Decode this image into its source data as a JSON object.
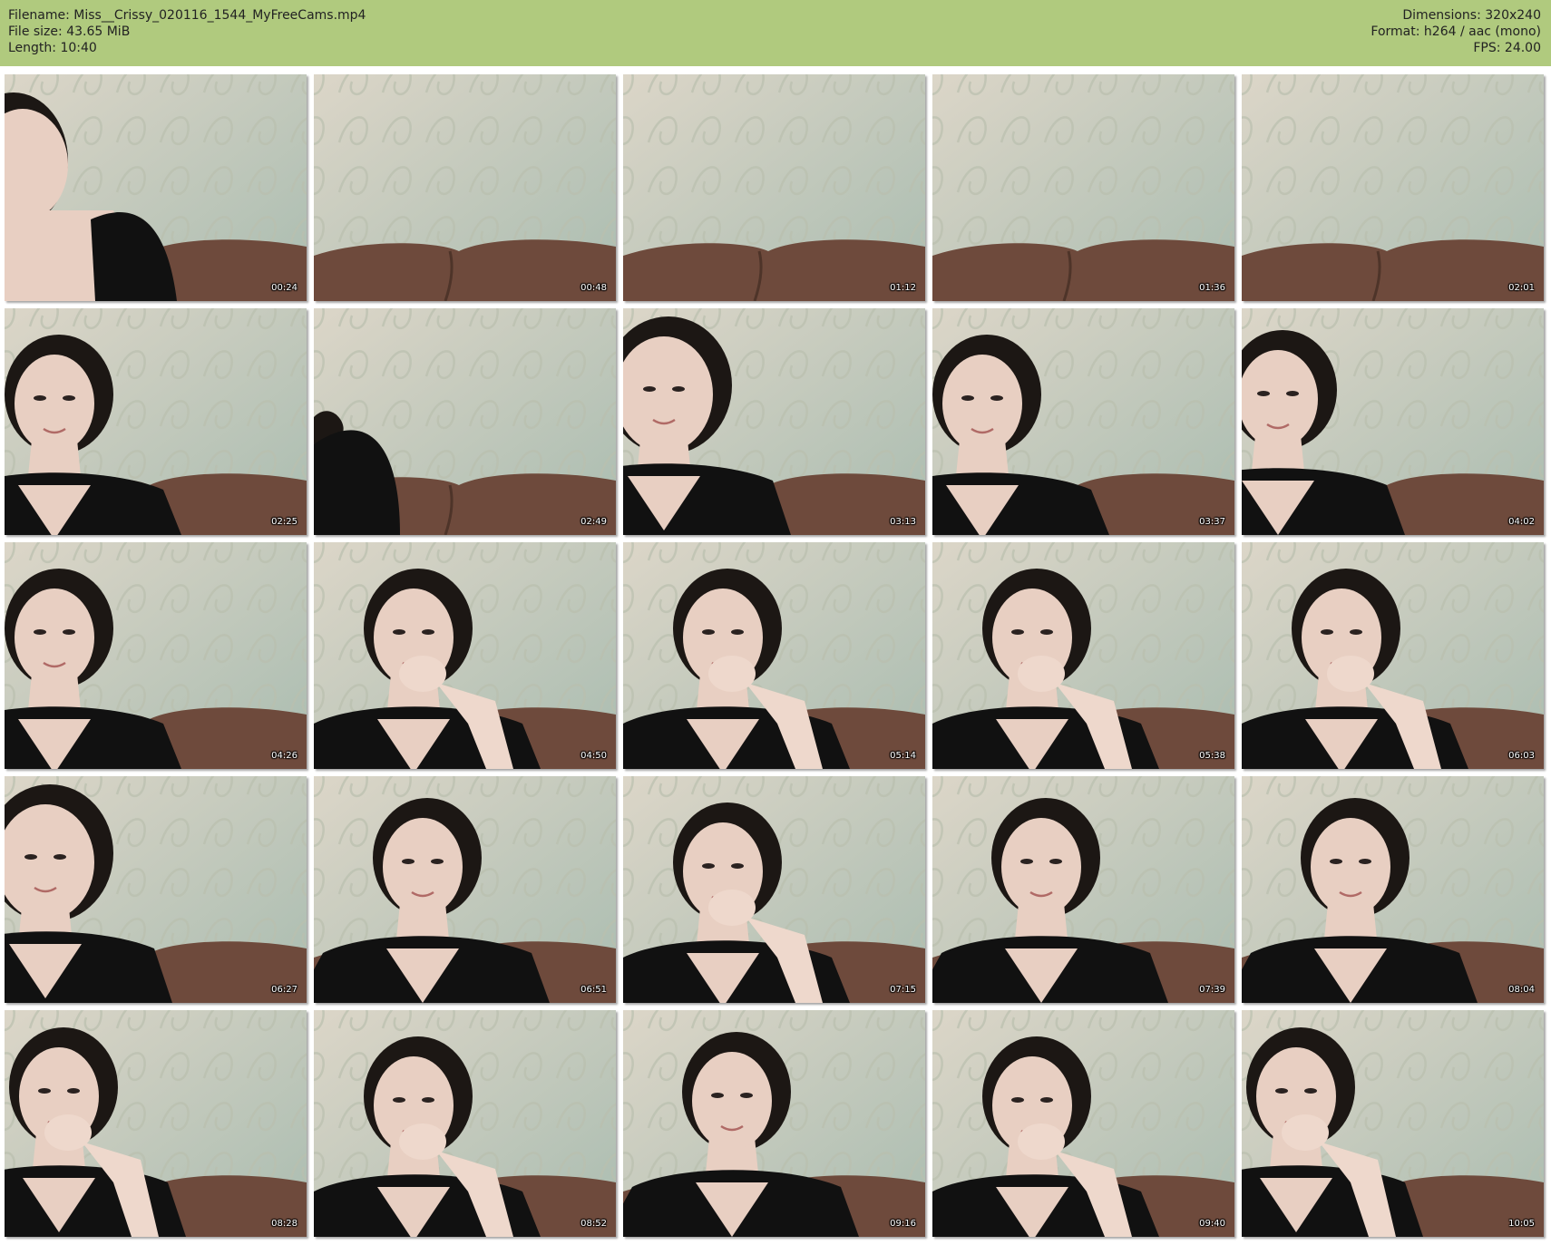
{
  "header": {
    "filename": "Filename: Miss__Crissy_020116_1544_MyFreeCams.mp4",
    "file_size": "File size: 43.65 MiB",
    "length": "Length: 10:40",
    "dimensions": "Dimensions: 320x240",
    "format": "Format: h264 / aac (mono)",
    "fps": "FPS: 24.00"
  },
  "colors": {
    "header_bg": "#b0ca7e",
    "wall": "#cfd3c5",
    "couch": "#6e4a3c",
    "shirt": "#111111",
    "skin": "#e8cfc2",
    "hair": "#1c1714"
  },
  "thumbnails": [
    {
      "time": "00:24",
      "person": "partial-left"
    },
    {
      "time": "00:48",
      "person": "none"
    },
    {
      "time": "01:12",
      "person": "none"
    },
    {
      "time": "01:36",
      "person": "none"
    },
    {
      "time": "02:01",
      "person": "none"
    },
    {
      "time": "02:25",
      "person": "left"
    },
    {
      "time": "02:49",
      "person": "shoulder"
    },
    {
      "time": "03:13",
      "person": "left-close"
    },
    {
      "time": "03:37",
      "person": "left"
    },
    {
      "time": "04:02",
      "person": "left-turned"
    },
    {
      "time": "04:26",
      "person": "left"
    },
    {
      "time": "04:50",
      "person": "center-hand"
    },
    {
      "time": "05:14",
      "person": "center-hand"
    },
    {
      "time": "05:38",
      "person": "center-hand"
    },
    {
      "time": "06:03",
      "person": "center-hand"
    },
    {
      "time": "06:27",
      "person": "left-close"
    },
    {
      "time": "06:51",
      "person": "center"
    },
    {
      "time": "07:15",
      "person": "center-hand"
    },
    {
      "time": "07:39",
      "person": "center"
    },
    {
      "time": "08:04",
      "person": "center"
    },
    {
      "time": "08:28",
      "person": "left-hand"
    },
    {
      "time": "08:52",
      "person": "center-hand"
    },
    {
      "time": "09:16",
      "person": "center"
    },
    {
      "time": "09:40",
      "person": "center-hand"
    },
    {
      "time": "10:05",
      "person": "left-hand"
    }
  ]
}
